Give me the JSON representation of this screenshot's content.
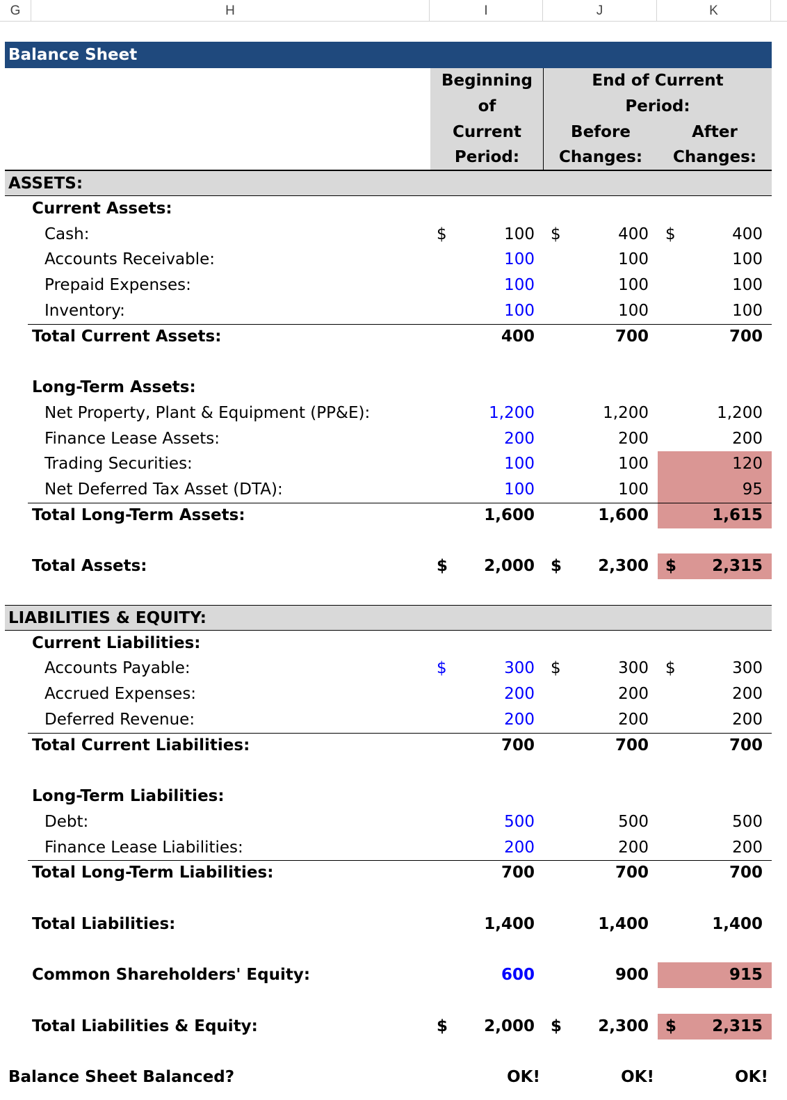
{
  "columns": [
    "G",
    "H",
    "I",
    "J",
    "K"
  ],
  "title": "Balance Sheet",
  "header": {
    "beginning": [
      "Beginning",
      "of",
      "Current",
      "Period:"
    ],
    "end_group": [
      "End of Current",
      "Period:"
    ],
    "before": [
      "Before",
      "Changes:"
    ],
    "after": [
      "After",
      "Changes:"
    ]
  },
  "currency": "$",
  "assets": {
    "section": "ASSETS:",
    "current_header": "Current Assets:",
    "cash": {
      "label": "Cash:",
      "i": "100",
      "j": "400",
      "k": "400"
    },
    "ar": {
      "label": "Accounts Receivable:",
      "i": "100",
      "j": "100",
      "k": "100"
    },
    "prepaid": {
      "label": "Prepaid Expenses:",
      "i": "100",
      "j": "100",
      "k": "100"
    },
    "inventory": {
      "label": "Inventory:",
      "i": "100",
      "j": "100",
      "k": "100"
    },
    "total_current": {
      "label": "Total Current Assets:",
      "i": "400",
      "j": "700",
      "k": "700"
    },
    "lt_header": "Long-Term Assets:",
    "ppe": {
      "label": "Net Property, Plant & Equipment (PP&E):",
      "i": "1,200",
      "j": "1,200",
      "k": "1,200"
    },
    "fla": {
      "label": "Finance Lease Assets:",
      "i": "200",
      "j": "200",
      "k": "200"
    },
    "trading": {
      "label": "Trading Securities:",
      "i": "100",
      "j": "100",
      "k": "120"
    },
    "dta": {
      "label": "Net Deferred Tax Asset (DTA):",
      "i": "100",
      "j": "100",
      "k": "95"
    },
    "total_lt": {
      "label": "Total Long-Term Assets:",
      "i": "1,600",
      "j": "1,600",
      "k": "1,615"
    },
    "total": {
      "label": "Total Assets:",
      "i": "2,000",
      "j": "2,300",
      "k": "2,315"
    }
  },
  "liabilities": {
    "section": "LIABILITIES & EQUITY:",
    "current_header": "Current Liabilities:",
    "ap": {
      "label": "Accounts Payable:",
      "i": "300",
      "j": "300",
      "k": "300"
    },
    "accrued": {
      "label": "Accrued Expenses:",
      "i": "200",
      "j": "200",
      "k": "200"
    },
    "deferred": {
      "label": "Deferred Revenue:",
      "i": "200",
      "j": "200",
      "k": "200"
    },
    "total_current": {
      "label": "Total Current Liabilities:",
      "i": "700",
      "j": "700",
      "k": "700"
    },
    "lt_header": "Long-Term Liabilities:",
    "debt": {
      "label": "Debt:",
      "i": "500",
      "j": "500",
      "k": "500"
    },
    "fll": {
      "label": "Finance Lease Liabilities:",
      "i": "200",
      "j": "200",
      "k": "200"
    },
    "total_lt": {
      "label": "Total Long-Term Liabilities:",
      "i": "700",
      "j": "700",
      "k": "700"
    },
    "total": {
      "label": "Total Liabilities:",
      "i": "1,400",
      "j": "1,400",
      "k": "1,400"
    },
    "equity": {
      "label": "Common Shareholders' Equity:",
      "i": "600",
      "j": "900",
      "k": "915"
    },
    "total_le": {
      "label": "Total Liabilities & Equity:",
      "i": "2,000",
      "j": "2,300",
      "k": "2,315"
    }
  },
  "check": {
    "label": "Balance Sheet Balanced?",
    "i": "OK!",
    "j": "OK!",
    "k": "OK!"
  },
  "colors": {
    "title_bg": "#1f497d",
    "header_gray": "#d9d9d9",
    "highlight": "#da9694",
    "input_blue": "#0000ff"
  }
}
